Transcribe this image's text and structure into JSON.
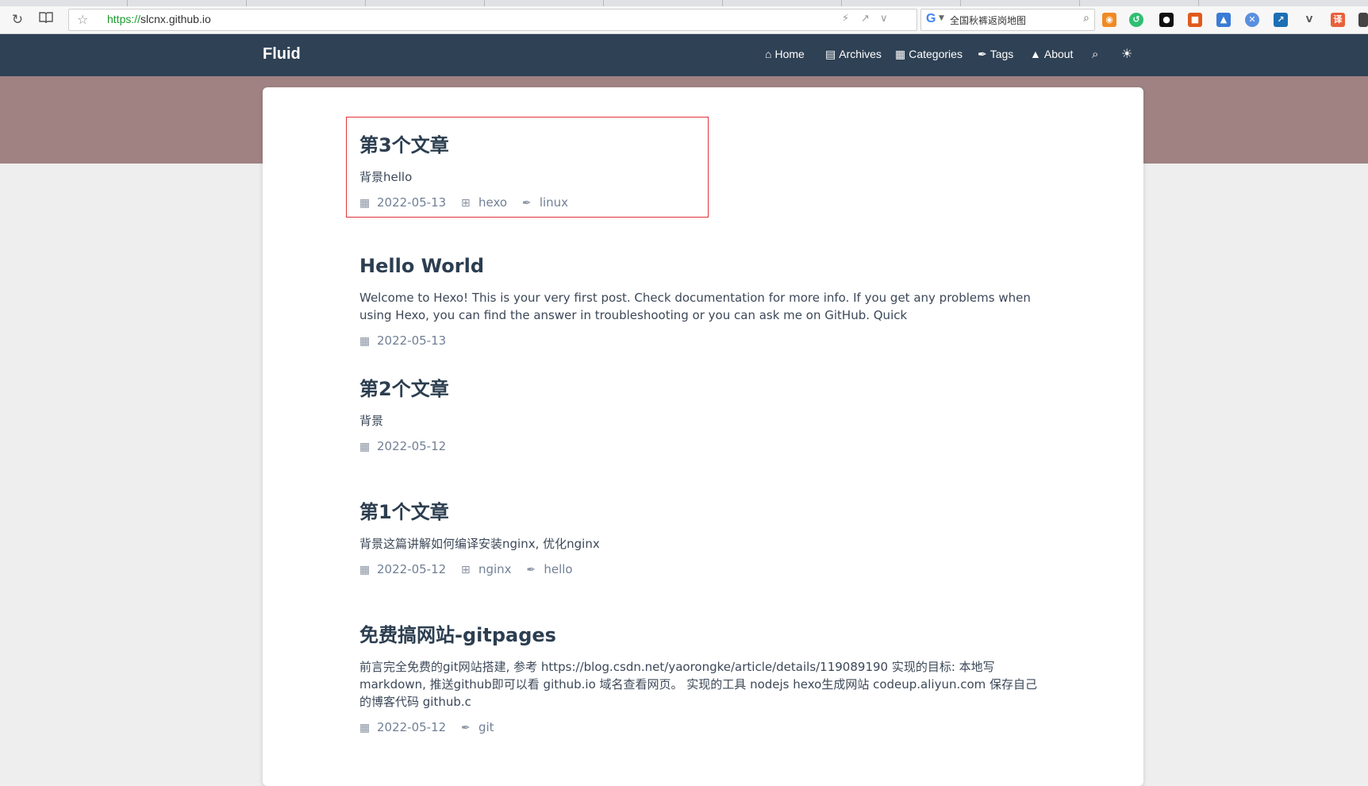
{
  "browser": {
    "url_protocol": "https://",
    "url_host": "slcnx.github.io",
    "search_query": "全国秋裤返岗地图",
    "icons": [
      "refresh-icon",
      "reader-icon",
      "star-icon",
      "flash-icon",
      "share-icon",
      "chevron-down-icon",
      "google-icon",
      "search-icon"
    ]
  },
  "site": {
    "brand": "Fluid",
    "nav": [
      {
        "label": "Home",
        "icon": "home-icon"
      },
      {
        "label": "Archives",
        "icon": "archive-icon"
      },
      {
        "label": "Categories",
        "icon": "categories-icon"
      },
      {
        "label": "Tags",
        "icon": "tags-icon"
      },
      {
        "label": "About",
        "icon": "user-icon"
      }
    ],
    "colors": {
      "navbar": "#2f4154",
      "banner": "#a08283",
      "highlight": "#e2323a"
    }
  },
  "posts": [
    {
      "title": "第3个文章",
      "excerpt": "背景hello",
      "date": "2022-05-13",
      "category": "hexo",
      "tag": "linux"
    },
    {
      "title": "Hello World",
      "excerpt": "Welcome to Hexo! This is your very first post. Check documentation for more info. If you get any problems when using Hexo, you can find the answer in troubleshooting or you can ask me on GitHub. Quick",
      "date": "2022-05-13"
    },
    {
      "title": "第2个文章",
      "excerpt": "背景",
      "date": "2022-05-12"
    },
    {
      "title": "第1个文章",
      "excerpt": "背景这篇讲解如何编译安装nginx, 优化nginx",
      "date": "2022-05-12",
      "category": "nginx",
      "tag": "hello"
    },
    {
      "title": "免费搞网站-gitpages",
      "excerpt": "前言完全免费的git网站搭建, 参考 https://blog.csdn.net/yaorongke/article/details/119089190 实现的目标: 本地写markdown, 推送github即可以看 github.io 域名查看网页。 实现的工具 nodejs hexo生成网站 codeup.aliyun.com 保存自己的博客代码 github.c",
      "date": "2022-05-12",
      "tag": "git"
    }
  ]
}
